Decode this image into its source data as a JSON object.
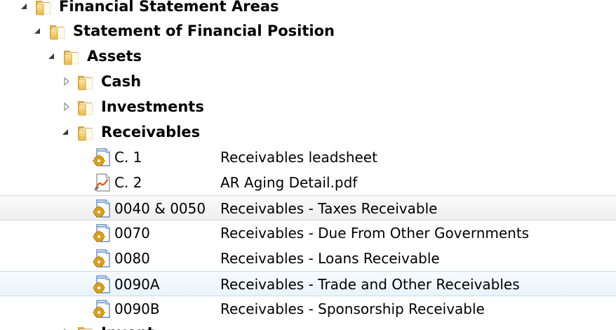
{
  "tree": {
    "folders": {
      "financial_statement_areas": "Financial Statement Areas",
      "statement_of_financial_position": "Statement of Financial Position",
      "assets": "Assets",
      "cash": "Cash",
      "investments": "Investments",
      "receivables": "Receivables",
      "inventory_partial": "Invent"
    },
    "documents": [
      {
        "code": "C. 1",
        "description": "Receivables leadsheet",
        "icon": "workpaper-gear-icon"
      },
      {
        "code": "C. 2",
        "description": "AR Aging Detail.pdf",
        "icon": "pdf-document-icon"
      },
      {
        "code": "0040 & 0050",
        "description": "Receivables - Taxes Receivable",
        "icon": "workpaper-gear-icon"
      },
      {
        "code": "0070",
        "description": "Receivables - Due From Other Governments",
        "icon": "workpaper-gear-icon"
      },
      {
        "code": "0080",
        "description": "Receivables - Loans Receivable",
        "icon": "workpaper-gear-icon"
      },
      {
        "code": "0090A",
        "description": "Receivables - Trade and Other Receivables",
        "icon": "workpaper-gear-icon"
      },
      {
        "code": "0090B",
        "description": "Receivables - Sponsorship Receivable",
        "icon": "workpaper-gear-icon"
      }
    ],
    "colors": {
      "folder_fill": "#f2cf6a",
      "folder_dark": "#d9a93a",
      "hover_row": "#eeeeee",
      "selected_row": "#eaf3fb"
    }
  }
}
